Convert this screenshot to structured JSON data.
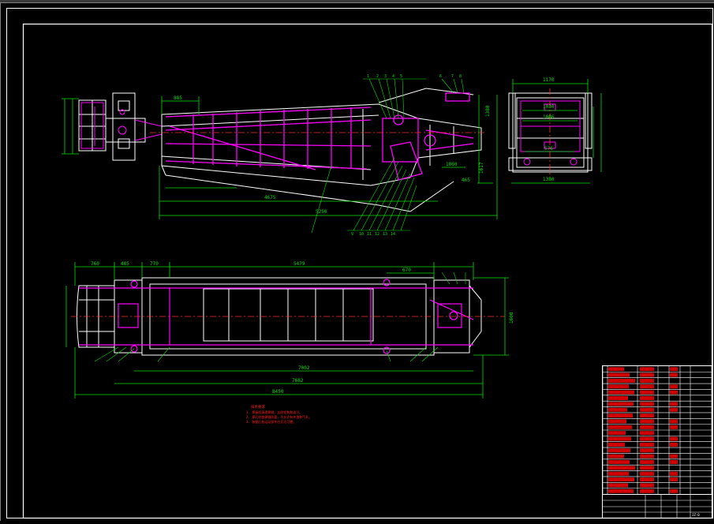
{
  "colors": {
    "background": "#000000",
    "frame": "#ffffff",
    "dimension": "#00e000",
    "outline": "#ffffff",
    "part": "#ff00ff",
    "centerline": "#ff3030",
    "note": "#ff2020",
    "table_fill": "#d00000"
  },
  "side_view": {
    "dims": {
      "d1": "885",
      "d2": "4675",
      "d3": "5250",
      "d4": "1060",
      "d5": "465",
      "d6": "1380",
      "d7": "1617"
    }
  },
  "end_view": {
    "dims": {
      "top": "1170",
      "inner_top": "1030",
      "inner_mid": "1006",
      "lower": "576",
      "bottom": "1380"
    }
  },
  "top_view": {
    "dims": {
      "left1": "760",
      "left2": "485",
      "left3": "770",
      "main": "5479",
      "right": "670",
      "total1": "7002",
      "total2": "7682",
      "total3": "8450",
      "height": "1600"
    }
  },
  "notes": {
    "heading": "技术要求",
    "lines": [
      "1. 焊接前清理焊缝，去除毛刺和油污。",
      "2. 焊后检查焊缝质量，不允许有夹渣和气孔。",
      "3. 装配后各运动部件应灵活可靠。"
    ]
  },
  "title_block": {
    "drawing_no": "JZ-0"
  }
}
